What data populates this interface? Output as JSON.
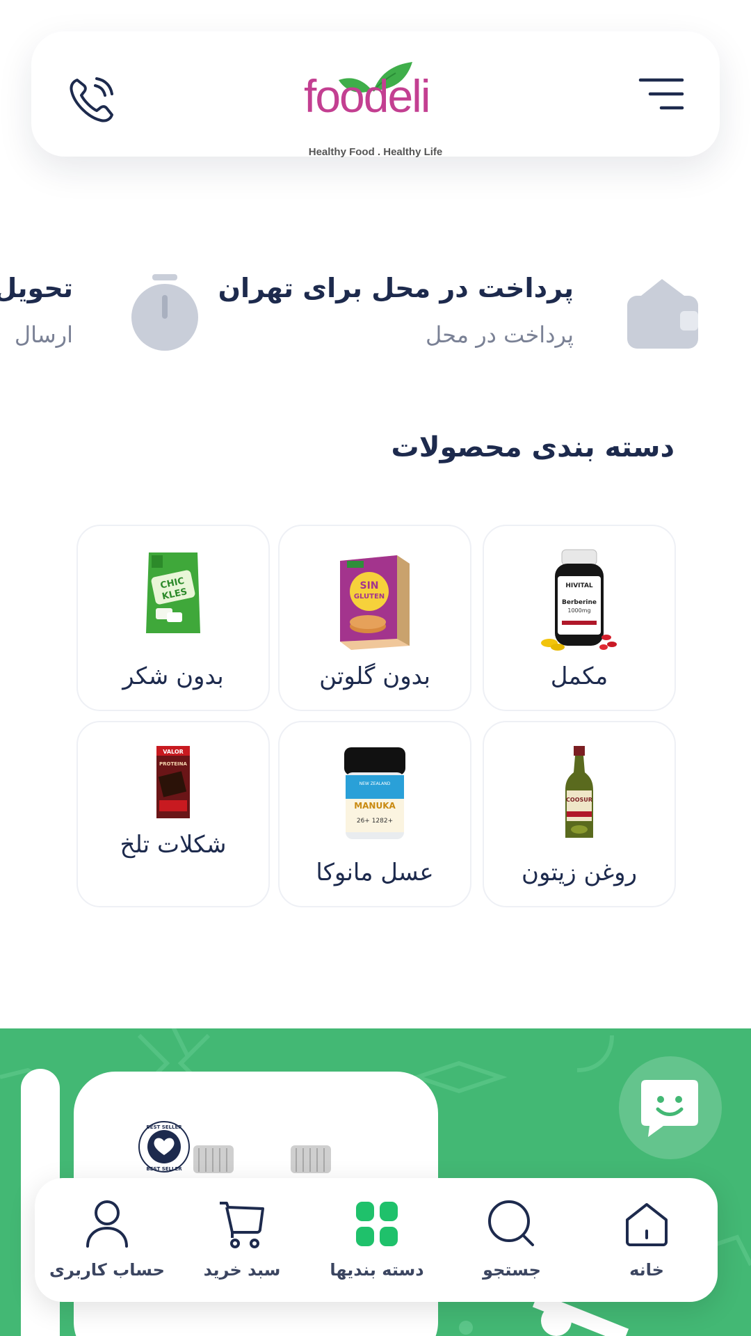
{
  "header": {
    "logo_word": "foodeli",
    "logo_tagline": "Healthy Food . Healthy Life",
    "phone_icon": "phone-icon",
    "menu_icon": "hamburger-menu-icon"
  },
  "features": [
    {
      "title": "پرداخت در محل برای تهران",
      "subtitle": "پرداخت در محل",
      "icon": "wallet-icon"
    },
    {
      "title": "تحویل",
      "subtitle": "ارسال",
      "icon": "timer-icon"
    }
  ],
  "categories_section": {
    "title": "دسته بندی محصولات",
    "items": [
      {
        "label": "مکمل",
        "icon": "supplement-bottle-image"
      },
      {
        "label": "بدون گلوتن",
        "icon": "gluten-free-box-image"
      },
      {
        "label": "بدون شکر",
        "icon": "sugar-free-gum-image"
      },
      {
        "label": "روغن زیتون",
        "icon": "olive-oil-bottle-image"
      },
      {
        "label": "عسل مانوکا",
        "icon": "manuka-honey-jar-image"
      },
      {
        "label": "شکلات تلخ",
        "icon": "dark-chocolate-image"
      }
    ]
  },
  "product_images": {
    "supplement": {
      "brand": "HIVITAL",
      "name": "Berberine",
      "dose": "1000mg"
    },
    "gluten_free": {
      "line1": "SIN",
      "line2": "GLUTEN"
    },
    "sugar_free": {
      "line1": "CHIC",
      "line2": "KLES"
    },
    "olive_oil": {
      "brand": "COOSUR"
    },
    "manuka": {
      "brand": "NEW ZEALAND",
      "name": "MANUKA",
      "grade": "26+  1282+"
    },
    "chocolate": {
      "brand": "VALOR",
      "name": "PROTEINA"
    }
  },
  "banner": {
    "badge_top": "BEST SELLER",
    "badge_bottom": "BEST SELLER",
    "chat_icon": "chat-smile-icon",
    "accent_color": "#43b874"
  },
  "bottom_nav": [
    {
      "label": "خانه",
      "icon": "home-icon"
    },
    {
      "label": "جستجو",
      "icon": "search-icon"
    },
    {
      "label": "دسته بندیها",
      "icon": "grid-icon"
    },
    {
      "label": "سبد خرید",
      "icon": "cart-icon"
    },
    {
      "label": "حساب کاربری",
      "icon": "user-icon"
    }
  ],
  "colors": {
    "brand_pink": "#c33f91",
    "brand_leaf": "#3fae4a",
    "navy_text": "#1d2a4d",
    "muted_text": "#7a8195",
    "nav_active": "#1fc16b"
  }
}
